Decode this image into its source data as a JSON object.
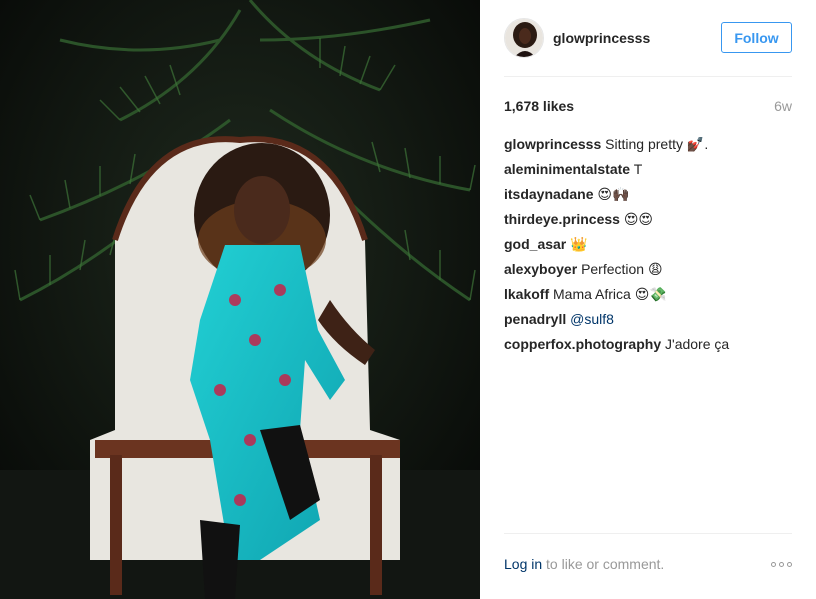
{
  "post": {
    "username": "glowprincesss",
    "follow_label": "Follow",
    "likes": "1,678 likes",
    "time_ago": "6w",
    "comments": [
      {
        "author": "glowprincesss",
        "text": "Sitting pretty",
        "emoji": "💅🏿",
        "tail": "."
      },
      {
        "author": "aleminimentalstate",
        "text": "T",
        "emoji": "",
        "tail": ""
      },
      {
        "author": "itsdaynadane",
        "text": "",
        "emoji": "😍🙌🏿",
        "tail": ""
      },
      {
        "author": "thirdeye.princess",
        "text": "",
        "emoji": "😍😍",
        "tail": ""
      },
      {
        "author": "god_asar",
        "text": "",
        "emoji": "👑",
        "tail": ""
      },
      {
        "author": "alexyboyer",
        "text": "Perfection",
        "emoji": "😩",
        "tail": ""
      },
      {
        "author": "lkakoff",
        "text": "Mama Africa",
        "emoji": "😍💸",
        "tail": ""
      },
      {
        "author": "penadryll",
        "text": "",
        "mention": "@sulf8",
        "emoji": "",
        "tail": ""
      },
      {
        "author": "copperfox.photography",
        "text": "J'adore ça",
        "emoji": "",
        "tail": ""
      }
    ],
    "login_link": "Log in",
    "login_suffix": " to like or comment."
  },
  "colors": {
    "accent": "#3897f0",
    "link": "#003569",
    "muted": "#999999",
    "dress": "#19c3c9"
  },
  "icons": {
    "more": "more-options-icon"
  }
}
